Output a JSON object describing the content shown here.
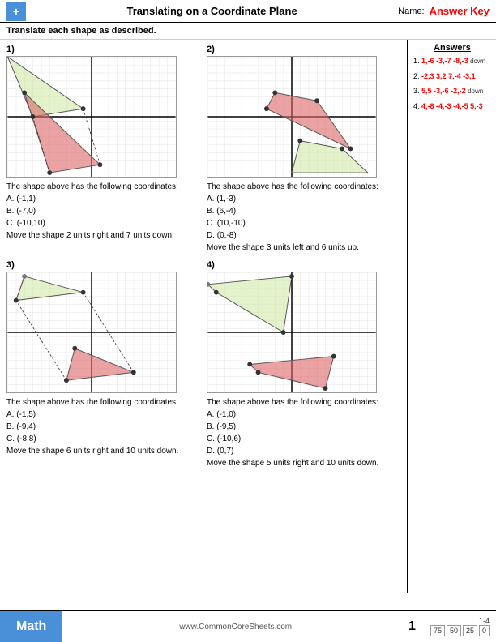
{
  "header": {
    "title": "Translating on a Coordinate Plane",
    "name_label": "Name:",
    "answer_key": "Answer Key",
    "logo": "+"
  },
  "instructions": "Translate each shape as described.",
  "problems": [
    {
      "number": "1)",
      "coordinates": "A. (-1,1)\nB. (-7,0)\nC. (-10,10)",
      "move": "Move the shape 2 units right and 7 units down.",
      "coords_label": "The shape above has the following coordinates:"
    },
    {
      "number": "2)",
      "coordinates": "A. (1,-3)\nB. (6,-4)\nC. (10,-10)\nD. (0,-8)",
      "move": "Move the shape 3 units left and 6 units up.",
      "coords_label": "The shape above has the following coordinates:"
    },
    {
      "number": "3)",
      "coordinates": "A. (-1,5)\nB. (-9,4)\nC. (-8,8)",
      "move": "Move the shape 6 units right and 10 units down.",
      "coords_label": "The shape above has the following coordinates:"
    },
    {
      "number": "4)",
      "coordinates": "A. (-1,0)\nB. (-9,5)\nC. (-10,6)\nD. (0,7)",
      "move": "Move the shape 5 units right and 10 units down.",
      "coords_label": "The shape above has the following coordinates:"
    }
  ],
  "answers": {
    "title": "Answers",
    "items": [
      {
        "num": "1.",
        "values": "1,-6  -3,-7  -8,-3",
        "extra": "down"
      },
      {
        "num": "2.",
        "values": "-2,3  3,2  7,-4  -3,1",
        "extra": ""
      },
      {
        "num": "3.",
        "values": "5,5  -3,-6  -2,-2",
        "extra": "down"
      },
      {
        "num": "4.",
        "values": "4,-8  -4,-3  -4,-5  5,-3",
        "extra": ""
      }
    ]
  },
  "footer": {
    "math_label": "Math",
    "url": "www.CommonCoreSheets.com",
    "page": "1",
    "range": "1-4",
    "scores": [
      "75",
      "50",
      "25",
      "0"
    ]
  }
}
